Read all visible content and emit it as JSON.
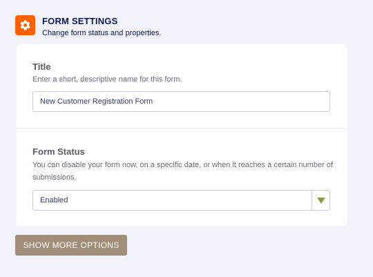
{
  "header": {
    "title": "FORM SETTINGS",
    "subtitle": "Change form status and properties.",
    "icon": "gear-icon",
    "icon_color": "#ff6100"
  },
  "title_section": {
    "label": "Title",
    "description": "Enter a short, descriptive name for this form.",
    "value": "New Customer Registration Form"
  },
  "status_section": {
    "label": "Form Status",
    "description": "You can disable your form now, on a specific date, or when it reaches a certain number of submissions.",
    "selected": "Enabled",
    "arrow_icon": "triangle-down-icon",
    "arrow_color": "#8a9a4a"
  },
  "more_button": {
    "label": "SHOW MORE OPTIONS",
    "color": "#a08e78"
  }
}
